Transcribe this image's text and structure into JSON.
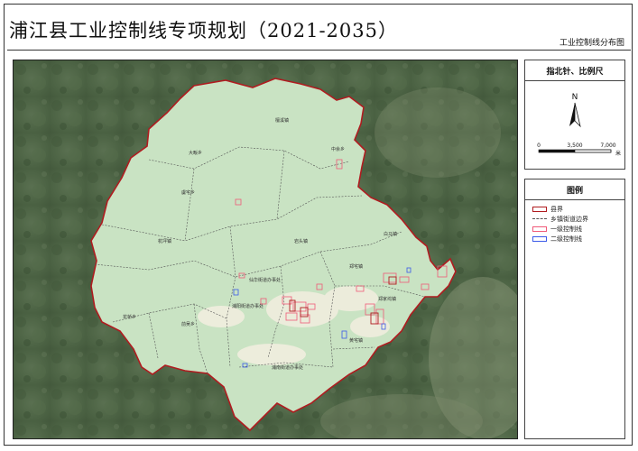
{
  "title": "浦江县工业控制线专项规划（2021-2035）",
  "subtitle": "工业控制线分布图",
  "north_panel": {
    "heading": "指北针、比例尺",
    "north_label": "N",
    "scale_ticks": [
      "0",
      "3,500",
      "7,000"
    ],
    "scale_unit": "米"
  },
  "legend": {
    "heading": "图例",
    "items": [
      {
        "label": "县界",
        "symbol": "county-boundary",
        "color": "#b01c20"
      },
      {
        "label": "乡镇街道边界",
        "symbol": "township-boundary",
        "color": "#555555"
      },
      {
        "label": "一级控制线",
        "symbol": "level1-control-line",
        "color": "#ef5a78"
      },
      {
        "label": "二级控制线",
        "symbol": "level2-control-line",
        "color": "#3c5be8"
      }
    ]
  },
  "map": {
    "place_names": [
      "檀溪镇",
      "中余乡",
      "大畈乡",
      "虞宅乡",
      "岩头镇",
      "杭坪镇",
      "白马镇",
      "郑宅镇",
      "仙华街道办事处",
      "浦阳街道办事处",
      "郑家坞镇",
      "花桥乡",
      "前吴乡",
      "黄宅镇",
      "浦南街道办事处"
    ],
    "colors": {
      "county_fill": "#c9e3c3",
      "county_boundary": "#b01c20",
      "satellite_base": "#4f6648",
      "urban": "#f3eee0"
    }
  }
}
